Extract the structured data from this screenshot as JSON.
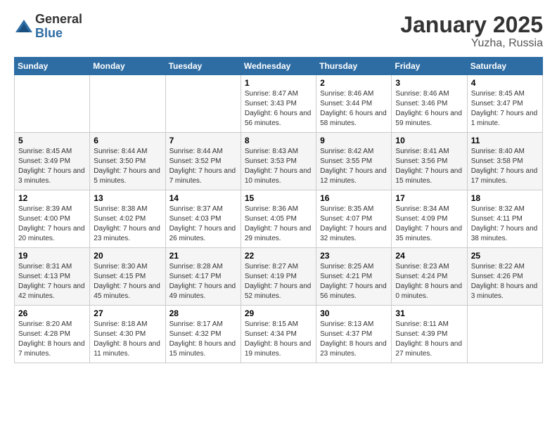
{
  "logo": {
    "general": "General",
    "blue": "Blue"
  },
  "header": {
    "title": "January 2025",
    "subtitle": "Yuzha, Russia"
  },
  "weekdays": [
    "Sunday",
    "Monday",
    "Tuesday",
    "Wednesday",
    "Thursday",
    "Friday",
    "Saturday"
  ],
  "weeks": [
    [
      {
        "day": "",
        "sunrise": "",
        "sunset": "",
        "daylight": ""
      },
      {
        "day": "",
        "sunrise": "",
        "sunset": "",
        "daylight": ""
      },
      {
        "day": "",
        "sunrise": "",
        "sunset": "",
        "daylight": ""
      },
      {
        "day": "1",
        "sunrise": "Sunrise: 8:47 AM",
        "sunset": "Sunset: 3:43 PM",
        "daylight": "Daylight: 6 hours and 56 minutes."
      },
      {
        "day": "2",
        "sunrise": "Sunrise: 8:46 AM",
        "sunset": "Sunset: 3:44 PM",
        "daylight": "Daylight: 6 hours and 58 minutes."
      },
      {
        "day": "3",
        "sunrise": "Sunrise: 8:46 AM",
        "sunset": "Sunset: 3:46 PM",
        "daylight": "Daylight: 6 hours and 59 minutes."
      },
      {
        "day": "4",
        "sunrise": "Sunrise: 8:45 AM",
        "sunset": "Sunset: 3:47 PM",
        "daylight": "Daylight: 7 hours and 1 minute."
      }
    ],
    [
      {
        "day": "5",
        "sunrise": "Sunrise: 8:45 AM",
        "sunset": "Sunset: 3:49 PM",
        "daylight": "Daylight: 7 hours and 3 minutes."
      },
      {
        "day": "6",
        "sunrise": "Sunrise: 8:44 AM",
        "sunset": "Sunset: 3:50 PM",
        "daylight": "Daylight: 7 hours and 5 minutes."
      },
      {
        "day": "7",
        "sunrise": "Sunrise: 8:44 AM",
        "sunset": "Sunset: 3:52 PM",
        "daylight": "Daylight: 7 hours and 7 minutes."
      },
      {
        "day": "8",
        "sunrise": "Sunrise: 8:43 AM",
        "sunset": "Sunset: 3:53 PM",
        "daylight": "Daylight: 7 hours and 10 minutes."
      },
      {
        "day": "9",
        "sunrise": "Sunrise: 8:42 AM",
        "sunset": "Sunset: 3:55 PM",
        "daylight": "Daylight: 7 hours and 12 minutes."
      },
      {
        "day": "10",
        "sunrise": "Sunrise: 8:41 AM",
        "sunset": "Sunset: 3:56 PM",
        "daylight": "Daylight: 7 hours and 15 minutes."
      },
      {
        "day": "11",
        "sunrise": "Sunrise: 8:40 AM",
        "sunset": "Sunset: 3:58 PM",
        "daylight": "Daylight: 7 hours and 17 minutes."
      }
    ],
    [
      {
        "day": "12",
        "sunrise": "Sunrise: 8:39 AM",
        "sunset": "Sunset: 4:00 PM",
        "daylight": "Daylight: 7 hours and 20 minutes."
      },
      {
        "day": "13",
        "sunrise": "Sunrise: 8:38 AM",
        "sunset": "Sunset: 4:02 PM",
        "daylight": "Daylight: 7 hours and 23 minutes."
      },
      {
        "day": "14",
        "sunrise": "Sunrise: 8:37 AM",
        "sunset": "Sunset: 4:03 PM",
        "daylight": "Daylight: 7 hours and 26 minutes."
      },
      {
        "day": "15",
        "sunrise": "Sunrise: 8:36 AM",
        "sunset": "Sunset: 4:05 PM",
        "daylight": "Daylight: 7 hours and 29 minutes."
      },
      {
        "day": "16",
        "sunrise": "Sunrise: 8:35 AM",
        "sunset": "Sunset: 4:07 PM",
        "daylight": "Daylight: 7 hours and 32 minutes."
      },
      {
        "day": "17",
        "sunrise": "Sunrise: 8:34 AM",
        "sunset": "Sunset: 4:09 PM",
        "daylight": "Daylight: 7 hours and 35 minutes."
      },
      {
        "day": "18",
        "sunrise": "Sunrise: 8:32 AM",
        "sunset": "Sunset: 4:11 PM",
        "daylight": "Daylight: 7 hours and 38 minutes."
      }
    ],
    [
      {
        "day": "19",
        "sunrise": "Sunrise: 8:31 AM",
        "sunset": "Sunset: 4:13 PM",
        "daylight": "Daylight: 7 hours and 42 minutes."
      },
      {
        "day": "20",
        "sunrise": "Sunrise: 8:30 AM",
        "sunset": "Sunset: 4:15 PM",
        "daylight": "Daylight: 7 hours and 45 minutes."
      },
      {
        "day": "21",
        "sunrise": "Sunrise: 8:28 AM",
        "sunset": "Sunset: 4:17 PM",
        "daylight": "Daylight: 7 hours and 49 minutes."
      },
      {
        "day": "22",
        "sunrise": "Sunrise: 8:27 AM",
        "sunset": "Sunset: 4:19 PM",
        "daylight": "Daylight: 7 hours and 52 minutes."
      },
      {
        "day": "23",
        "sunrise": "Sunrise: 8:25 AM",
        "sunset": "Sunset: 4:21 PM",
        "daylight": "Daylight: 7 hours and 56 minutes."
      },
      {
        "day": "24",
        "sunrise": "Sunrise: 8:23 AM",
        "sunset": "Sunset: 4:24 PM",
        "daylight": "Daylight: 8 hours and 0 minutes."
      },
      {
        "day": "25",
        "sunrise": "Sunrise: 8:22 AM",
        "sunset": "Sunset: 4:26 PM",
        "daylight": "Daylight: 8 hours and 3 minutes."
      }
    ],
    [
      {
        "day": "26",
        "sunrise": "Sunrise: 8:20 AM",
        "sunset": "Sunset: 4:28 PM",
        "daylight": "Daylight: 8 hours and 7 minutes."
      },
      {
        "day": "27",
        "sunrise": "Sunrise: 8:18 AM",
        "sunset": "Sunset: 4:30 PM",
        "daylight": "Daylight: 8 hours and 11 minutes."
      },
      {
        "day": "28",
        "sunrise": "Sunrise: 8:17 AM",
        "sunset": "Sunset: 4:32 PM",
        "daylight": "Daylight: 8 hours and 15 minutes."
      },
      {
        "day": "29",
        "sunrise": "Sunrise: 8:15 AM",
        "sunset": "Sunset: 4:34 PM",
        "daylight": "Daylight: 8 hours and 19 minutes."
      },
      {
        "day": "30",
        "sunrise": "Sunrise: 8:13 AM",
        "sunset": "Sunset: 4:37 PM",
        "daylight": "Daylight: 8 hours and 23 minutes."
      },
      {
        "day": "31",
        "sunrise": "Sunrise: 8:11 AM",
        "sunset": "Sunset: 4:39 PM",
        "daylight": "Daylight: 8 hours and 27 minutes."
      },
      {
        "day": "",
        "sunrise": "",
        "sunset": "",
        "daylight": ""
      }
    ]
  ]
}
